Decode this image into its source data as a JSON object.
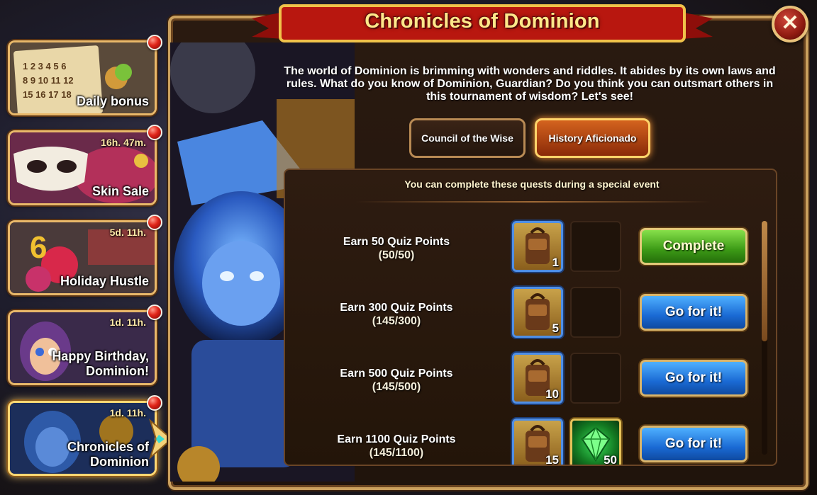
{
  "window": {
    "title": "Chronicles of Dominion",
    "intro": "The world of Dominion is brimming with wonders and riddles. It abides by its own laws and rules. What do you know of Dominion, Guardian? Do you think you can outsmart others in this tournament of wisdom? Let's see!"
  },
  "sidebar": {
    "items": [
      {
        "label": "Daily bonus",
        "timer": "",
        "notification": true
      },
      {
        "label": "Skin Sale",
        "timer": "16h. 47m.",
        "notification": true
      },
      {
        "label": "Holiday Hustle",
        "timer": "5d. 11h.",
        "notification": true
      },
      {
        "label": "Happy Birthday,\nDominion!",
        "timer": "1d. 11h.",
        "notification": true
      },
      {
        "label": "Chronicles of\nDominion",
        "timer": "1d. 11h.",
        "notification": true,
        "selected": true
      }
    ]
  },
  "tabs": [
    {
      "label": "Council of the Wise",
      "active": false
    },
    {
      "label": "History Aficionado",
      "active": true
    }
  ],
  "quests": {
    "header": "You can complete these quests during a special event",
    "items": [
      {
        "title": "Earn 50 Quiz Points",
        "progress": "(50/50)",
        "reward1_qty": "1",
        "reward2_qty": "",
        "action": "Complete"
      },
      {
        "title": "Earn 300 Quiz Points",
        "progress": "(145/300)",
        "reward1_qty": "5",
        "reward2_qty": "",
        "action": "Go for it!"
      },
      {
        "title": "Earn 500 Quiz Points",
        "progress": "(145/500)",
        "reward1_qty": "10",
        "reward2_qty": "",
        "action": "Go for it!"
      },
      {
        "title": "Earn 1100 Quiz Points",
        "progress": "(145/1100)",
        "reward1_qty": "15",
        "reward2_qty": "50",
        "action": "Go for it!"
      }
    ]
  },
  "icons": {
    "close": "close-icon",
    "reward_item": "backpack-icon",
    "reward_gem": "emerald-icon",
    "notification": "notification-dot-icon"
  },
  "colors": {
    "title_gold": "#ffe88a",
    "banner_red": "#b8170f",
    "button_blue": "#1a6ad4",
    "button_green": "#3c9a16",
    "frame_gold": "#caa05e"
  }
}
